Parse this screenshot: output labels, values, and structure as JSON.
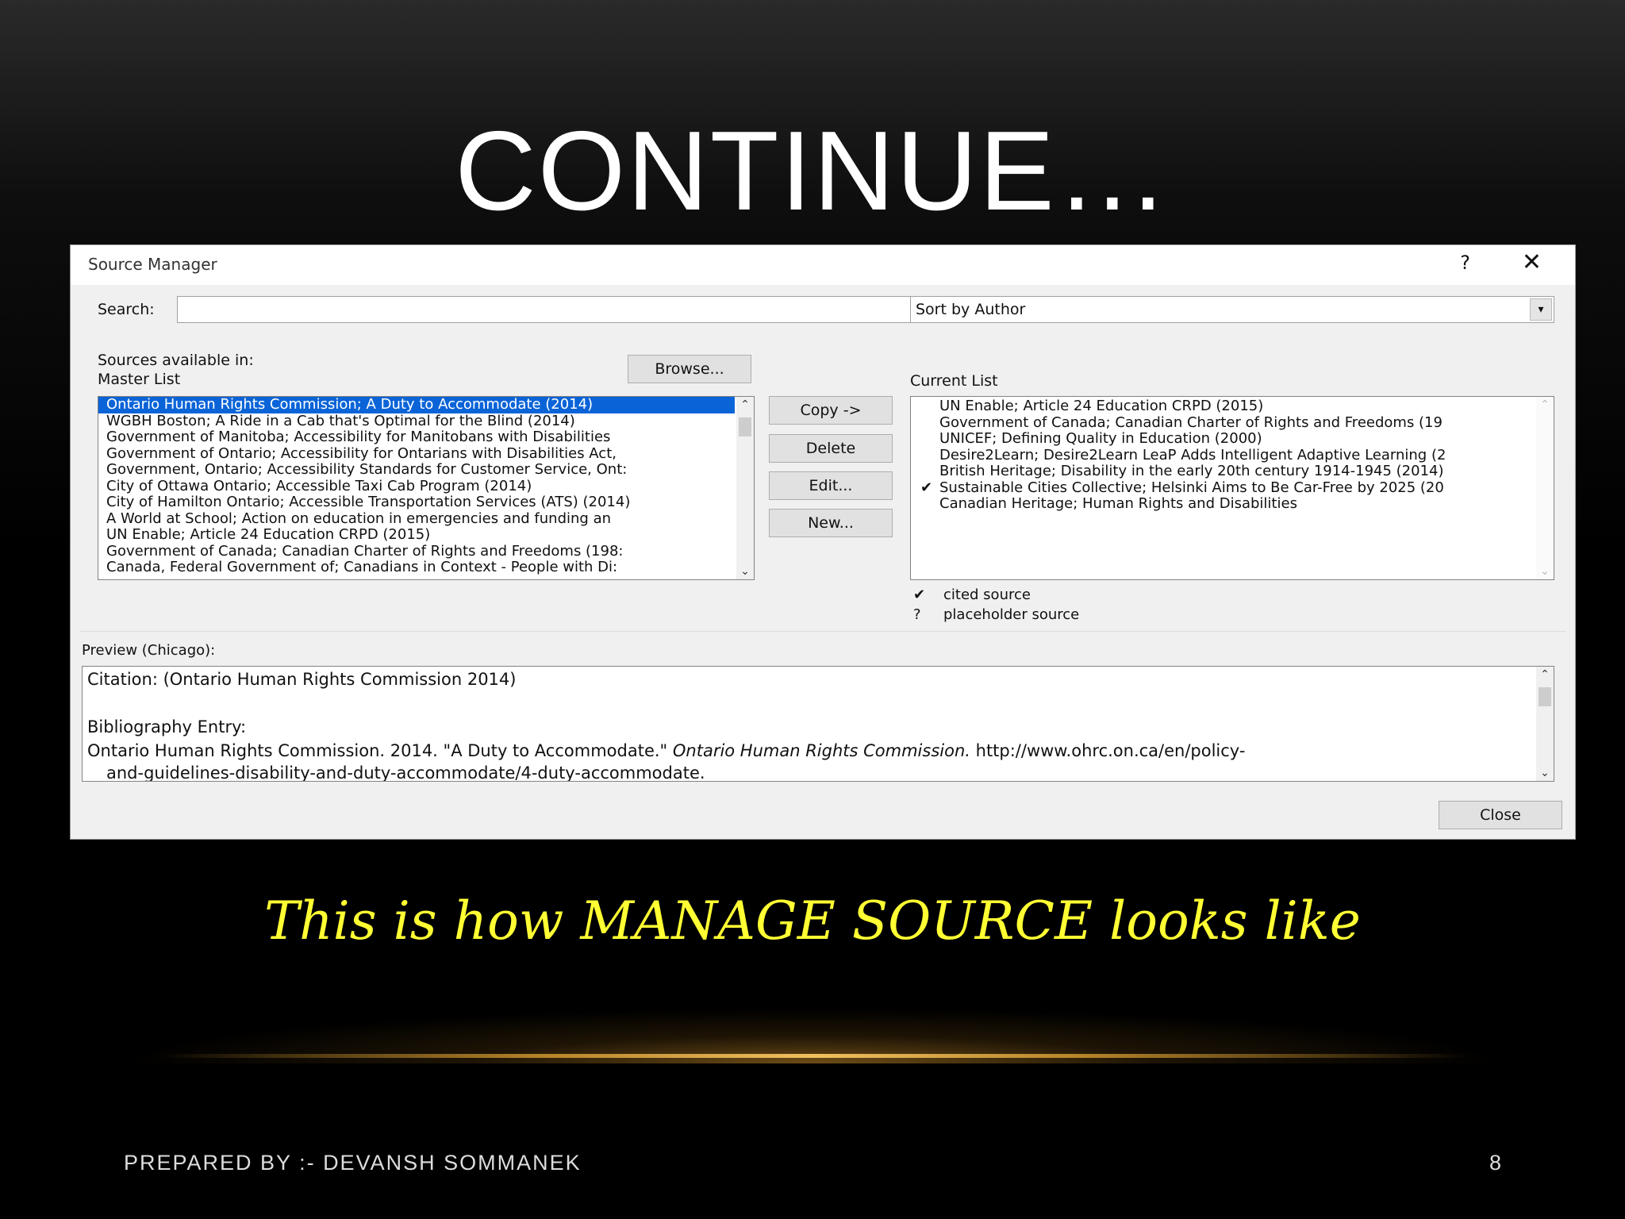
{
  "slide": {
    "title": "CONTINUE…",
    "caption": "This is how MANAGE SOURCE looks like",
    "footer": "PREPARED BY :- DEVANSH SOMMANEK",
    "page_number": "8"
  },
  "dialog": {
    "title": "Source Manager",
    "help": "?",
    "close": "✕",
    "search_label": "Search:",
    "search_value": "",
    "sort_value": "Sort by Author",
    "sources_label": "Sources available in:",
    "master_label": "Master List",
    "browse": "Browse...",
    "current_label": "Current List",
    "buttons": {
      "copy": "Copy ->",
      "delete": "Delete",
      "edit": "Edit...",
      "new": "New..."
    },
    "master_list": [
      "Ontario Human Rights Commission; A Duty to Accommodate (2014)",
      "WGBH Boston; A Ride in a Cab that's Optimal for the Blind (2014)",
      "Government of Manitoba; Accessibility for Manitobans with Disabilities",
      "Government of Ontario; Accessibility for Ontarians with Disabilities Act,",
      "Government, Ontario; Accessibility Standards for Customer Service, Ont:",
      "City of Ottawa Ontario; Accessible Taxi Cab Program (2014)",
      "City of Hamilton Ontario; Accessible Transportation Services (ATS) (2014)",
      "A World at School; Action on education in emergencies and funding an",
      "UN Enable; Article 24 Education CRPD (2015)",
      "Government of Canada; Canadian Charter of Rights and Freedoms (198:",
      "Canada, Federal Government of; Canadians in Context - People with Di:"
    ],
    "current_list": [
      {
        "mark": "",
        "text": "UN Enable; Article 24 Education CRPD (2015)"
      },
      {
        "mark": "",
        "text": "Government of Canada; Canadian Charter of Rights and Freedoms (19"
      },
      {
        "mark": "",
        "text": "UNICEF; Defining Quality in Education (2000)"
      },
      {
        "mark": "",
        "text": "Desire2Learn; Desire2Learn LeaP Adds Intelligent Adaptive Learning (2"
      },
      {
        "mark": "",
        "text": "British Heritage; Disability in the early 20th century 1914-1945 (2014)"
      },
      {
        "mark": "✔",
        "text": "Sustainable Cities Collective; Helsinki Aims to Be Car-Free by 2025 (20"
      },
      {
        "mark": "",
        "text": "Canadian Heritage; Human Rights and Disabilities"
      }
    ],
    "legend": [
      {
        "mark": "✔",
        "text": "cited source"
      },
      {
        "mark": "?",
        "text": "placeholder source"
      }
    ],
    "preview_label": "Preview (Chicago):",
    "preview": {
      "citation": "Citation:  (Ontario Human Rights Commission 2014)",
      "bib_label": "Bibliography Entry:",
      "bib_line1_start": "Ontario Human Rights Commission. 2014. \"A Duty to Accommodate.\" ",
      "bib_line1_italic": "Ontario Human Rights Commission.",
      "bib_line1_end": " http://www.ohrc.on.ca/en/policy-",
      "bib_line2": "and-guidelines-disability-and-duty-accommodate/4-duty-accommodate."
    },
    "close_button": "Close"
  },
  "colors": {
    "caption": "#ffff33",
    "selection": "#0a64d8",
    "accent_line": "#f0c060"
  }
}
